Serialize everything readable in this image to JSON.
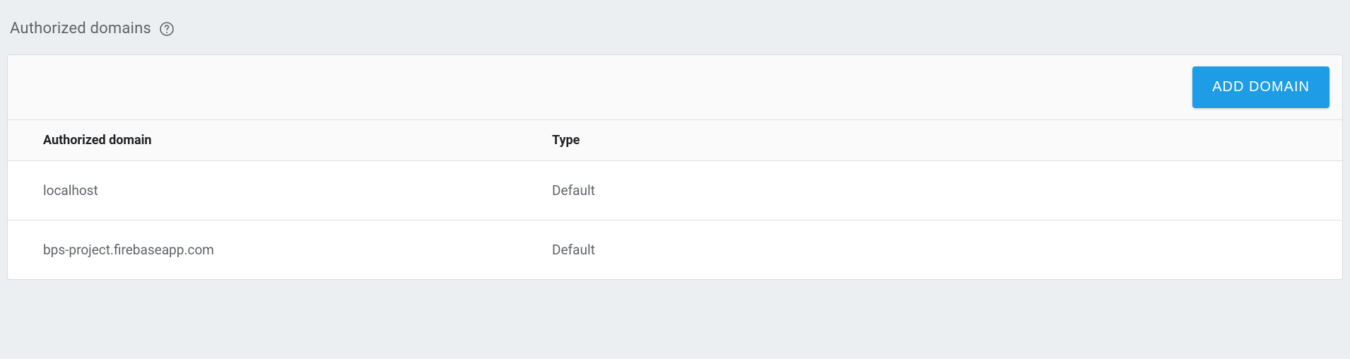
{
  "section": {
    "title": "Authorized domains"
  },
  "toolbar": {
    "add_button_label": "ADD DOMAIN"
  },
  "table": {
    "headers": {
      "domain": "Authorized domain",
      "type": "Type"
    },
    "rows": [
      {
        "domain": "localhost",
        "type": "Default"
      },
      {
        "domain": "bps-project.firebaseapp.com",
        "type": "Default"
      }
    ]
  }
}
